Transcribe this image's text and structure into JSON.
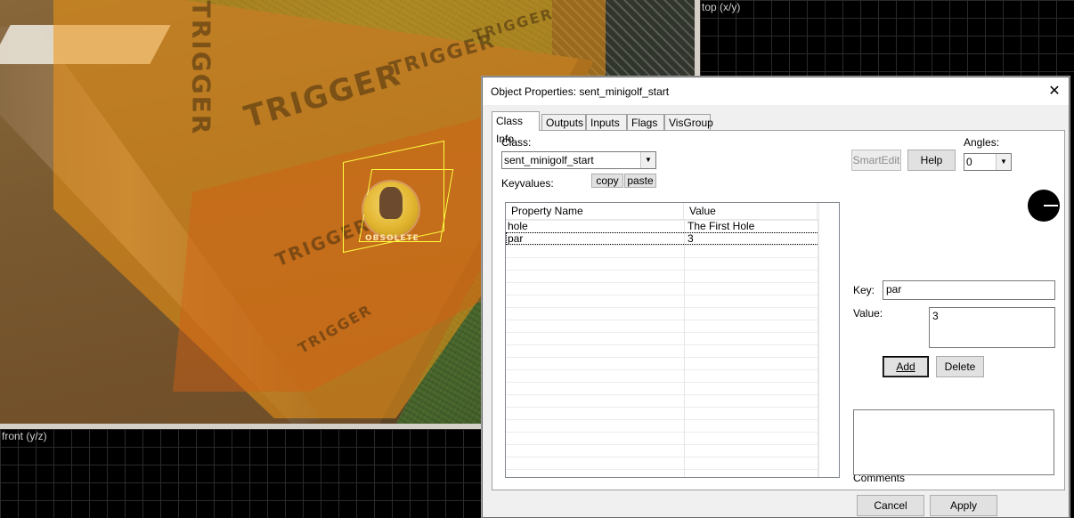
{
  "viewports": {
    "top_label": "top (x/y)",
    "front_label": "front (y/z)",
    "trigger_text": "TRIGGER",
    "entity_label": "OBSOLETE"
  },
  "dialog": {
    "title": "Object Properties: sent_minigolf_start",
    "close_glyph": "✕",
    "tabs": [
      "Class Info",
      "Outputs",
      "Inputs",
      "Flags",
      "VisGroup"
    ],
    "active_tab": "Class Info",
    "class_label": "Class:",
    "class_value": "sent_minigolf_start",
    "keyvalues_label": "Keyvalues:",
    "copy_label": "copy",
    "paste_label": "paste",
    "smartedit_label": "SmartEdit",
    "help_label": "Help",
    "angles_label": "Angles:",
    "angles_value": "0",
    "table": {
      "columns": [
        "Property Name",
        "Value"
      ],
      "rows": [
        {
          "name": "hole",
          "value": "The First Hole"
        },
        {
          "name": "par",
          "value": "3"
        }
      ],
      "selected_row": 1
    },
    "key_label": "Key:",
    "key_value": "par",
    "value_label": "Value:",
    "value_value": "3",
    "add_label": "Add",
    "delete_label": "Delete",
    "comments_label": "Comments",
    "comments_value": "",
    "cancel_label": "Cancel",
    "apply_label": "Apply"
  }
}
